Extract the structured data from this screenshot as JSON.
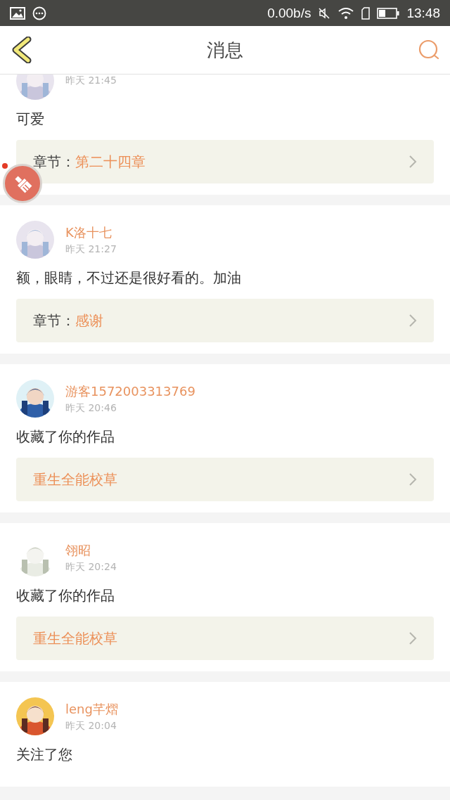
{
  "status_bar": {
    "speed": "0.00b/s",
    "time": "13:48"
  },
  "header": {
    "title": "消息"
  },
  "messages": [
    {
      "time": "昨天 21:45",
      "text": "可爱",
      "link": {
        "kind": "chapter",
        "label": "章节：",
        "value": "第二十四章"
      }
    },
    {
      "name": "K洛十七",
      "time": "昨天 21:27",
      "text": "额，眼睛，不过还是很好看的。加油",
      "link": {
        "kind": "chapter",
        "label": "章节：",
        "value": "感谢"
      }
    },
    {
      "name": "游客1572003313769",
      "time": "昨天 20:46",
      "text": "收藏了你的作品",
      "link": {
        "kind": "work",
        "value": "重生全能校草"
      }
    },
    {
      "name": "翎昭",
      "time": "昨天 20:24",
      "text": "收藏了你的作品",
      "link": {
        "kind": "work",
        "value": "重生全能校草"
      }
    },
    {
      "name": "leng芊熠",
      "time": "昨天 20:04",
      "text": "关注了您"
    }
  ]
}
